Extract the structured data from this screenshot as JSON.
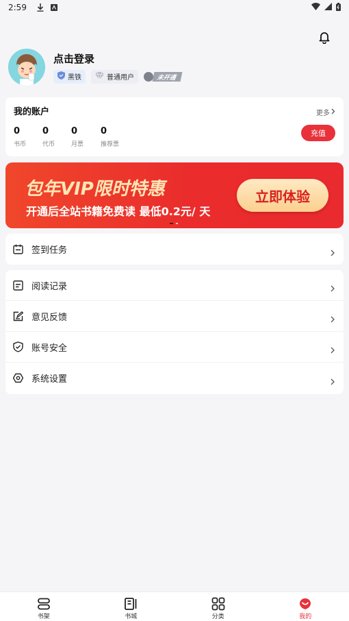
{
  "status_bar": {
    "time": "2:59"
  },
  "profile": {
    "login_text": "点击登录",
    "badges": {
      "level": "黑铁",
      "user_type": "普通用户",
      "vip": "未开通"
    }
  },
  "account": {
    "title": "我的账户",
    "more_label": "更多",
    "recharge_label": "充值",
    "stats": [
      {
        "value": "0",
        "label": "书币"
      },
      {
        "value": "0",
        "label": "代币"
      },
      {
        "value": "0",
        "label": "月票"
      },
      {
        "value": "0",
        "label": "推荐票"
      }
    ]
  },
  "banner": {
    "title": "包年VIP限时特惠",
    "subtitle": "开通后全站书籍免费读 最低0.2元/ 天",
    "button_label": "立即体验"
  },
  "sign_in": {
    "label": "签到任务"
  },
  "menu": [
    {
      "label": "阅读记录",
      "icon": "reading-record-icon"
    },
    {
      "label": "意见反馈",
      "icon": "feedback-icon"
    },
    {
      "label": "账号安全",
      "icon": "shield-icon"
    },
    {
      "label": "系统设置",
      "icon": "settings-icon"
    }
  ],
  "tabs": [
    {
      "label": "书架",
      "icon": "bookshelf-icon"
    },
    {
      "label": "书城",
      "icon": "bookstore-icon"
    },
    {
      "label": "分类",
      "icon": "category-icon"
    },
    {
      "label": "我的",
      "icon": "mine-icon"
    }
  ],
  "colors": {
    "accent": "#e8313a",
    "banner_text": "#ffe6b5"
  }
}
